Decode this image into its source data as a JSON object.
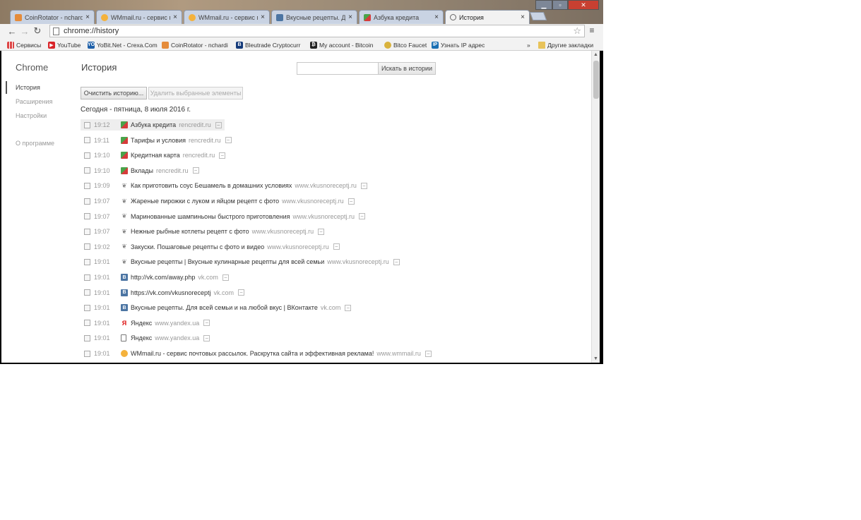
{
  "window": {
    "tabs": [
      {
        "title": "CoinRotator - nchardi",
        "active": false
      },
      {
        "title": "WMmail.ru - сервис по",
        "active": false
      },
      {
        "title": "WMmail.ru - сервис по",
        "active": false
      },
      {
        "title": "Вкусные рецепты. Д...",
        "active": false
      },
      {
        "title": "Азбука кредита",
        "active": false
      },
      {
        "title": "История",
        "active": true
      }
    ],
    "close_glyph": "×"
  },
  "toolbar": {
    "back": "←",
    "forward": "→",
    "reload": "↻",
    "url": "chrome://history",
    "star": "☆",
    "menu": "≡"
  },
  "bookmarks": {
    "items": [
      {
        "label": "Сервисы",
        "icon": "apps-icon"
      },
      {
        "label": "YouTube",
        "icon": "youtube-icon"
      },
      {
        "label": "YoBit.Net - Crexa.Com",
        "icon": "yobit-icon"
      },
      {
        "label": "CoinRotator - nchardi",
        "icon": "coinrotator-icon"
      },
      {
        "label": "Bleutrade Cryptocurr",
        "icon": "bleutrade-icon"
      },
      {
        "label": "My account - Bitcoin",
        "icon": "account-icon"
      },
      {
        "label": "Bitco Faucet",
        "icon": "faucet-icon"
      },
      {
        "label": "Узнать IP адрес",
        "icon": "ip-icon"
      }
    ],
    "overflow": "»",
    "other": "Другие закладки"
  },
  "page": {
    "brand": "Chrome",
    "sidebar": [
      {
        "label": "История",
        "selected": true
      },
      {
        "label": "Расширения",
        "selected": false
      },
      {
        "label": "Настройки",
        "selected": false
      },
      {
        "label": "О программе",
        "selected": false
      }
    ],
    "title": "История",
    "search_button": "Искать в истории",
    "clear_button": "Очистить историю...",
    "remove_button": "Удалить выбранные элементы",
    "day_header": "Сегодня - пятница, 8 июля 2016 г.",
    "entries": [
      {
        "time": "19:12",
        "title": "Азбука кредита",
        "domain": "rencredit.ru",
        "icon": "green"
      },
      {
        "time": "19:11",
        "title": "Тарифы и условия",
        "domain": "rencredit.ru",
        "icon": "green"
      },
      {
        "time": "19:10",
        "title": "Кредитная карта",
        "domain": "rencredit.ru",
        "icon": "green"
      },
      {
        "time": "19:10",
        "title": "Вклады",
        "domain": "rencredit.ru",
        "icon": "green"
      },
      {
        "time": "19:09",
        "title": "Как приготовить соус Бешамель в домашних условиях",
        "domain": "www.vkusnoreceptj.ru",
        "icon": "chef"
      },
      {
        "time": "19:07",
        "title": "Жареные пирожки с луком и яйцом рецепт с фото",
        "domain": "www.vkusnoreceptj.ru",
        "icon": "chef"
      },
      {
        "time": "19:07",
        "title": "Маринованные шампиньоны быстрого приготовления",
        "domain": "www.vkusnoreceptj.ru",
        "icon": "chef"
      },
      {
        "time": "19:07",
        "title": "Нежные рыбные котлеты рецепт с фото",
        "domain": "www.vkusnoreceptj.ru",
        "icon": "chef"
      },
      {
        "time": "19:02",
        "title": "Закуски. Пошаговые рецепты с фото и видео",
        "domain": "www.vkusnoreceptj.ru",
        "icon": "chef"
      },
      {
        "time": "19:01",
        "title": "Вкусные рецепты | Вкусные кулинарные рецепты для всей семьи",
        "domain": "www.vkusnoreceptj.ru",
        "icon": "chef"
      },
      {
        "time": "19:01",
        "title": "http://vk.com/away.php",
        "domain": "vk.com",
        "icon": "vk"
      },
      {
        "time": "19:01",
        "title": "https://vk.com/vkusnoreceptj",
        "domain": "vk.com",
        "icon": "vk"
      },
      {
        "time": "19:01",
        "title": "Вкусные рецепты. Для всей семьи и на любой вкус | ВКонтакте",
        "domain": "vk.com",
        "icon": "vk"
      },
      {
        "time": "19:01",
        "title": "Яндекс",
        "domain": "www.yandex.ua",
        "icon": "ya"
      },
      {
        "time": "19:01",
        "title": "Яндекс",
        "domain": "www.yandex.ua",
        "icon": "doc"
      },
      {
        "time": "19:01",
        "title": "WMmail.ru - сервис почтовых рассылок. Раскрутка сайта и эффективная реклама!",
        "domain": "www.wmmail.ru",
        "icon": "wm"
      }
    ],
    "row_menu_glyph": "–"
  },
  "colors": {
    "vk": "#4c75a3",
    "close": "#c84031",
    "accent": "#555555"
  }
}
